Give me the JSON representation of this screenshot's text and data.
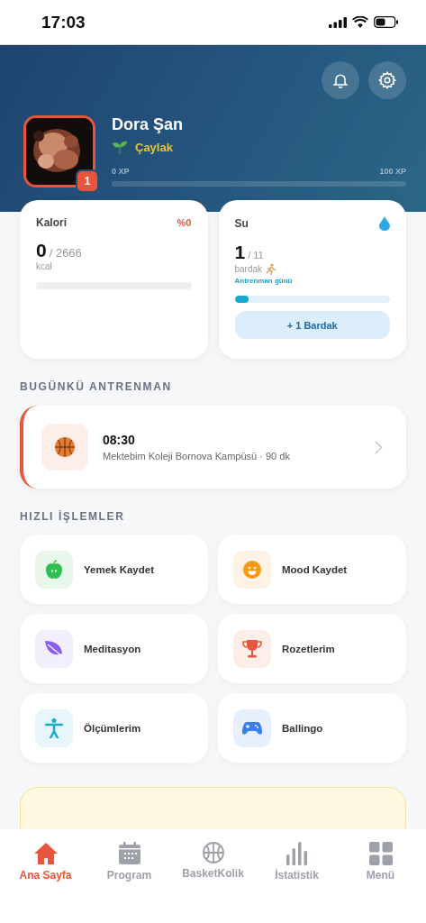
{
  "status_bar": {
    "time": "17:03"
  },
  "profile": {
    "name": "Dora Şan",
    "rank": "Çaylak",
    "level_badge": "1",
    "xp_min": "0 XP",
    "xp_max": "100 XP",
    "level": 0
  },
  "calorie_card": {
    "title": "Kalori",
    "percent": "%0",
    "value": "0",
    "target": "/ 2666",
    "unit": "kcal",
    "level": 0
  },
  "water_card": {
    "title": "Su",
    "value": "1",
    "target": "/ 11",
    "unit": "bardak",
    "note": "Antrenman günü",
    "level": 0.09,
    "button": "+ 1 Bardak"
  },
  "training_section": {
    "title": "BUGÜNKÜ ANTRENMAN",
    "time": "08:30",
    "detail": "Mektebim Koleji Bornova Kampüsü · 90 dk"
  },
  "quick_actions": {
    "title": "HIZLI İŞLEMLER",
    "items": [
      {
        "label": "Yemek Kaydet",
        "kind": "apple"
      },
      {
        "label": "Mood Kaydet",
        "kind": "mood"
      },
      {
        "label": "Meditasyon",
        "kind": "leaf"
      },
      {
        "label": "Rozetlerim",
        "kind": "trophy"
      },
      {
        "label": "Ölçümlerim",
        "kind": "body"
      },
      {
        "label": "Ballingo",
        "kind": "game"
      }
    ]
  },
  "tab_bar": [
    {
      "label": "Ana Sayfa",
      "kind": "home",
      "selected": true
    },
    {
      "label": "Program",
      "kind": "calendar",
      "selected": false
    },
    {
      "label": "BasketKolik",
      "kind": "ball",
      "selected": false
    },
    {
      "label": "İstatistik",
      "kind": "stats",
      "selected": false
    },
    {
      "label": "Menü",
      "kind": "grid",
      "selected": false
    }
  ]
}
